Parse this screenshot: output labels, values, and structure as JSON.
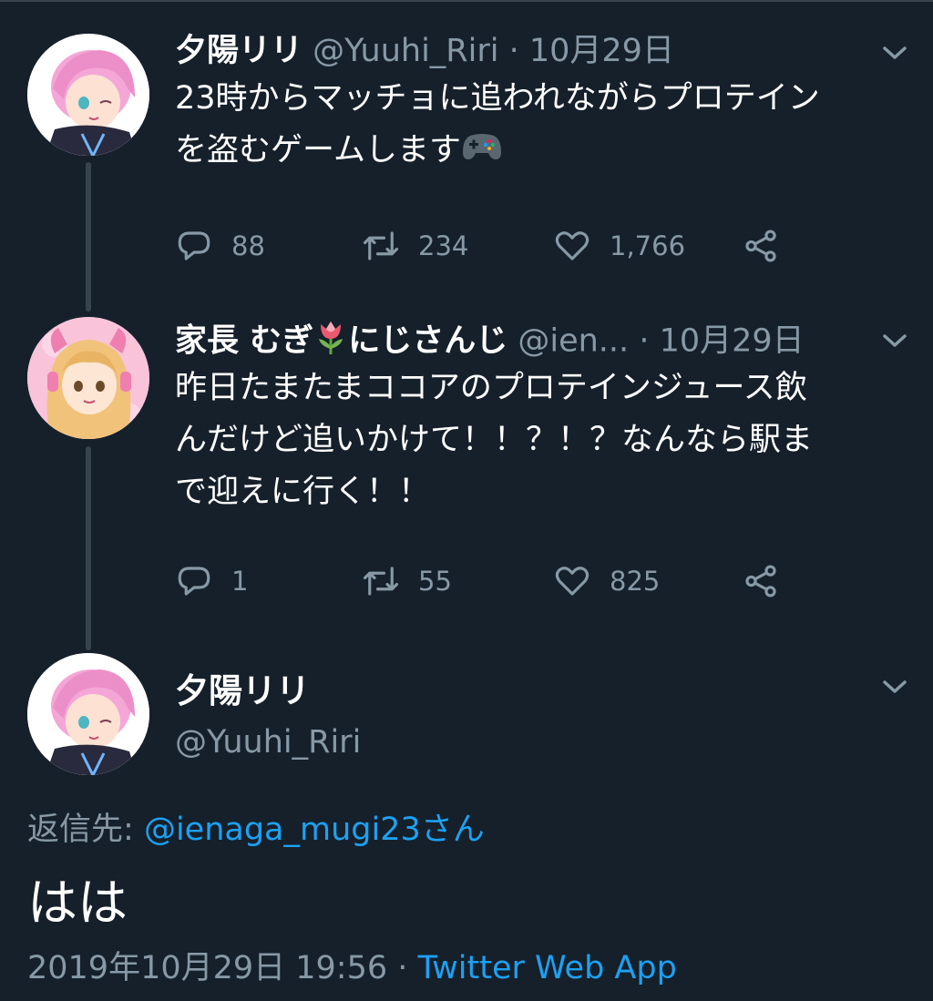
{
  "tweets": [
    {
      "name": "夕陽リリ",
      "handle": "@Yuuhi_Riri",
      "sep": "·",
      "date": "10月29日",
      "text_line1": "23時からマッチョに追われながらプロテイン",
      "text_line2": "を盗むゲームします",
      "emoji": "game-controller",
      "replies": "88",
      "retweets": "234",
      "likes": "1,766"
    },
    {
      "name": "家長 むぎ",
      "name_suffix": "にじさんじ",
      "emoji": "tulip",
      "handle": "@ien...",
      "sep": "·",
      "date": "10月29日",
      "text_line1": "昨日たまたまココアのプロテインジュース飲",
      "text_line2": "んだけど追いかけて！！？！？なんなら駅ま",
      "text_line3": "で迎えに行く！！",
      "replies": "1",
      "retweets": "55",
      "likes": "825"
    }
  ],
  "focused": {
    "name": "夕陽リリ",
    "handle": "@Yuuhi_Riri",
    "reply_label": "返信先:",
    "reply_handle": "@ienaga_mugi23",
    "reply_suffix": "さん",
    "text": "はは",
    "timestamp": "2019年10月29日 19:56",
    "sep": "·",
    "source": "Twitter Web App"
  },
  "colors": {
    "background": "#15202b",
    "secondary_text": "#8899a6",
    "link": "#1da1f2",
    "divider": "#38444d"
  }
}
